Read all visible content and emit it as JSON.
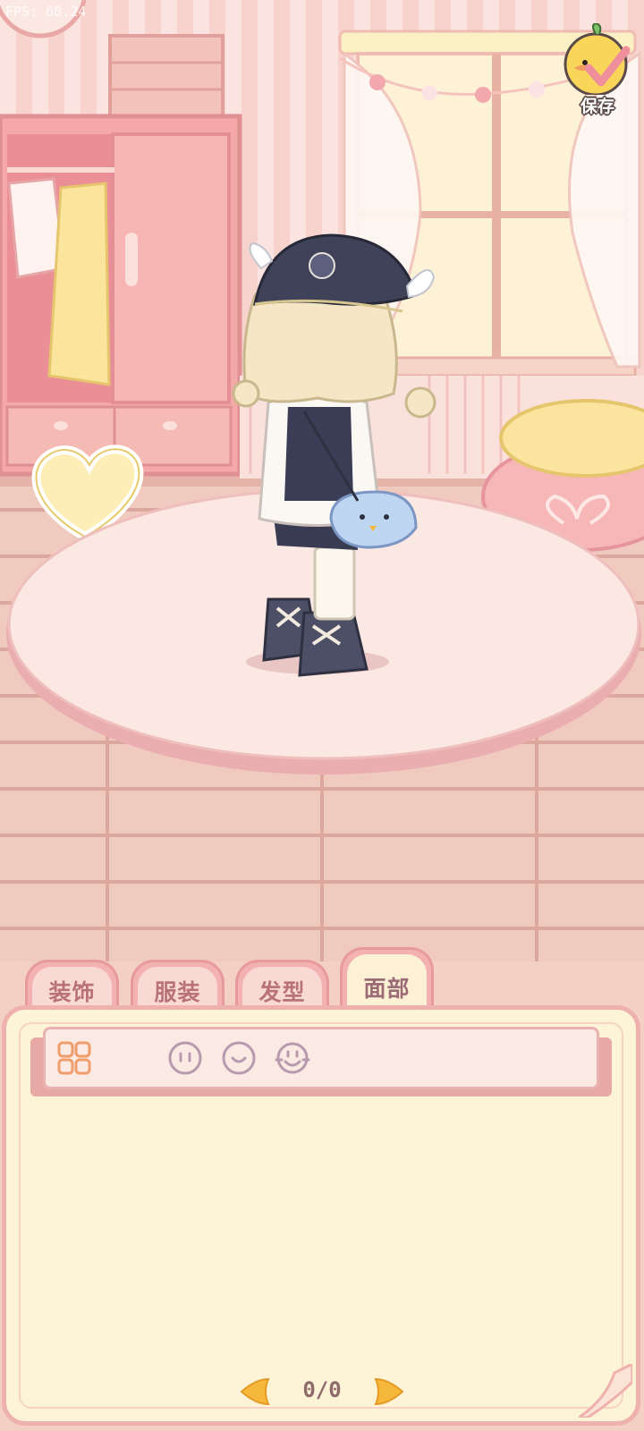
{
  "hud": {
    "fps_text": "FPS: 60.24"
  },
  "save": {
    "label": "保存",
    "icon": "duck-check-icon"
  },
  "tabs": [
    {
      "label": "装饰",
      "active": false
    },
    {
      "label": "服装",
      "active": false
    },
    {
      "label": "发型",
      "active": false
    },
    {
      "label": "面部",
      "active": true
    }
  ],
  "filters": {
    "icons": [
      "grid-all-icon",
      "face-eyes-icon",
      "face-smile-icon",
      "face-mouth-icon"
    ]
  },
  "pager": {
    "text": "0/0"
  },
  "colors": {
    "accent": "#efb1ad",
    "panel_bg": "#fdf3d7",
    "tab_text": "#b9717a",
    "arrow": "#f5b83b"
  }
}
